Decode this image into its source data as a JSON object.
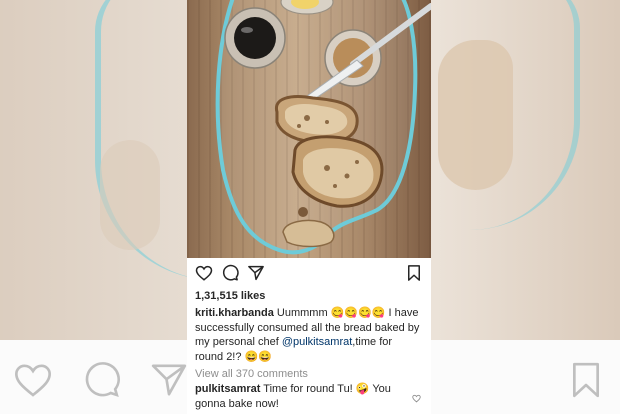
{
  "post": {
    "likes": "1,31,515 likes",
    "caption": {
      "user": "kriti.kharbanda",
      "text_before": "Uummmm 😋😋😋😋 I have successfully consumed all the bread baked by my personal chef",
      "mention": "@pulkitsamrat",
      "text_after": ",time for round 2!? 😄😄"
    },
    "view_all_comments": "View all 370 comments",
    "top_comment": {
      "user": "pulkitsamrat",
      "text": "Time for round Tu! 🤪 You gonna bake now!"
    }
  },
  "icons": {
    "like": "heart-icon",
    "comment": "comment-bubble-icon",
    "share": "paper-plane-icon",
    "save": "bookmark-icon",
    "comment_like": "small-heart-icon"
  },
  "colors": {
    "glass_rim": "#6ecbd8",
    "wood": "#a88867",
    "mention": "#003569",
    "secondary_text": "#8e8e8e"
  }
}
